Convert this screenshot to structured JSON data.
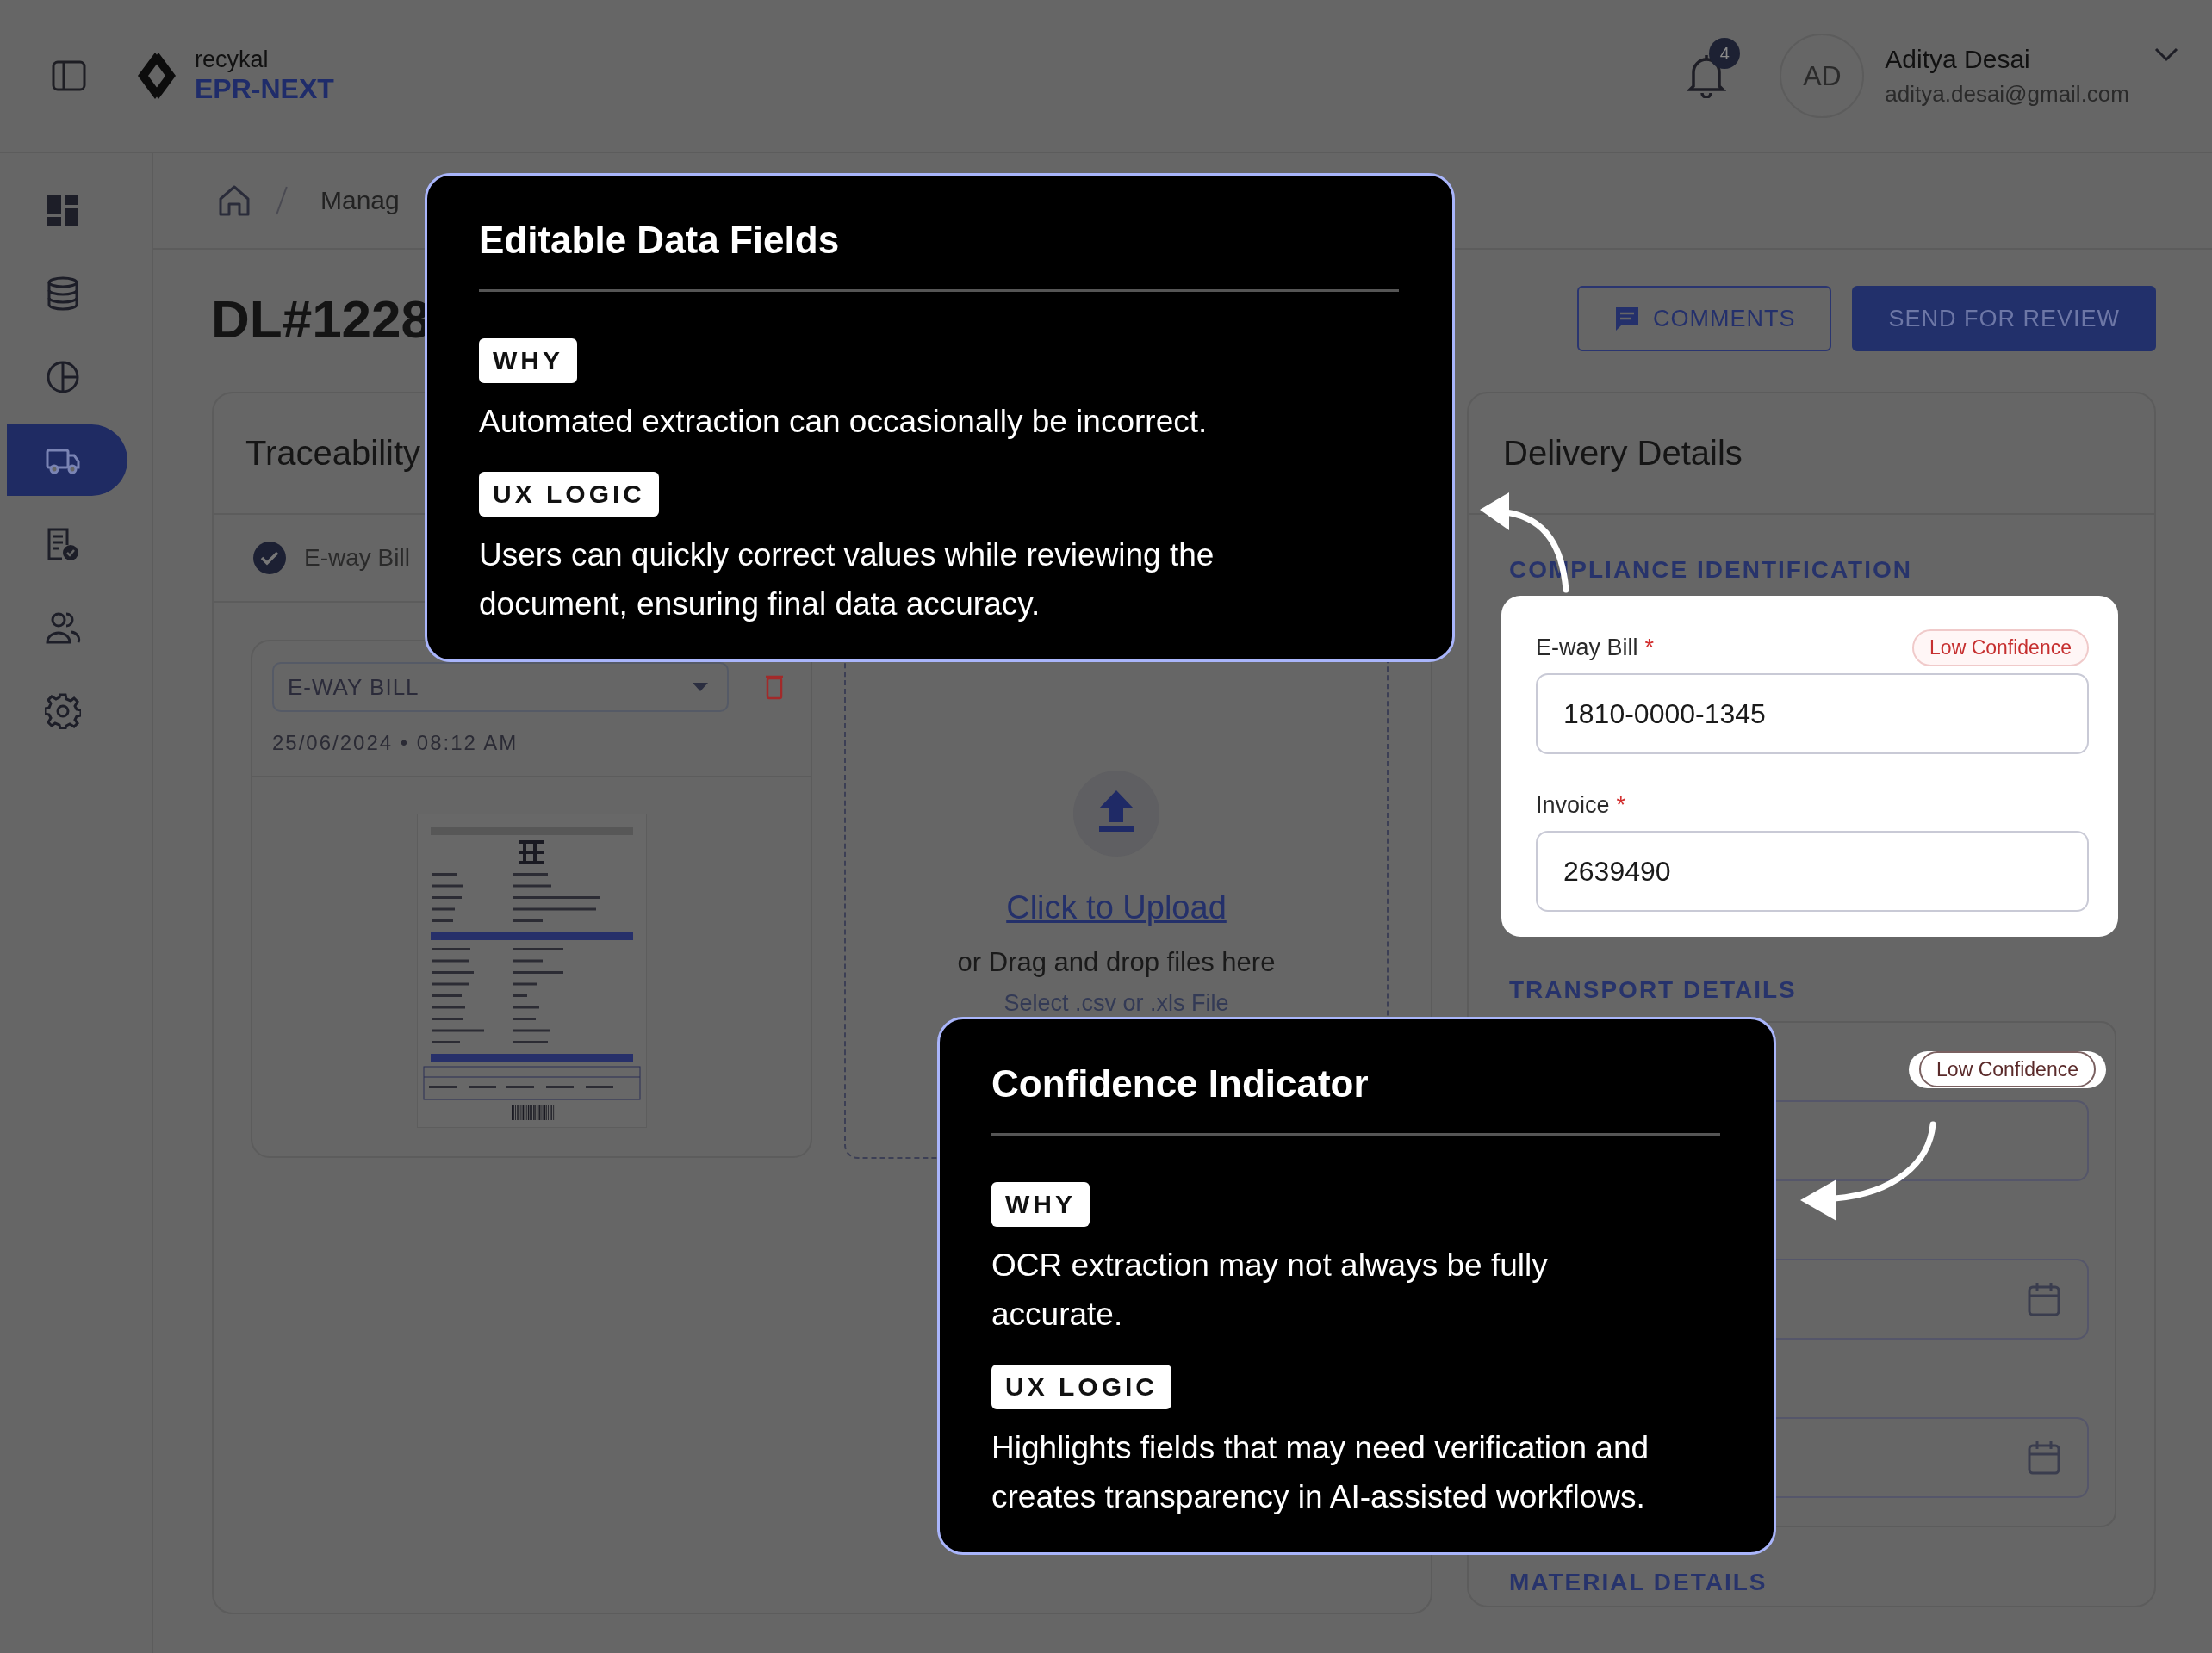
{
  "header": {
    "brand": "recykal",
    "product": "EPR-NEXT",
    "notifications": "4",
    "user": {
      "initials": "AD",
      "name": "Aditya Desai",
      "email": "aditya.desai@gmail.com"
    }
  },
  "sidebar": {
    "items": [
      {
        "selected": false
      },
      {
        "selected": false
      },
      {
        "selected": false
      },
      {
        "selected": true
      },
      {
        "selected": false
      },
      {
        "selected": false
      },
      {
        "selected": false
      }
    ]
  },
  "breadcrumb": [
    "Manag"
  ],
  "page": {
    "title": "DL#1228",
    "buttons": [
      {
        "label": "COMMENTS",
        "kind": "outline"
      },
      {
        "label": "SEND FOR REVIEW",
        "kind": "primary"
      }
    ]
  },
  "traceability": {
    "title": "Traceability",
    "tabs": [
      {
        "label": "E-way Bill",
        "checked": true
      }
    ],
    "document": {
      "type": "E-WAY BILL",
      "timestamp": "25/06/2024 • 08:12 AM"
    },
    "upload": {
      "link": "Click to Upload",
      "hint": "or Drag and drop files here",
      "formats": "Select .csv or .xls File"
    }
  },
  "delivery": {
    "title": "Delivery Details",
    "sections": [
      {
        "title": "COMPLIANCE IDENTIFICATION",
        "highlighted": true,
        "fields": [
          {
            "kind": "text",
            "label": "E-way Bill",
            "required_mark": "*",
            "value": "1810-0000-1345",
            "badge": "Low Confidence"
          },
          {
            "kind": "text",
            "label": "Invoice",
            "required_mark": "*",
            "value": "2639490"
          }
        ]
      },
      {
        "title": "TRANSPORT DETAILS",
        "highlighted": false,
        "fields": [
          {
            "kind": "text",
            "badge": "Low Confidence",
            "badge_highlighted": true
          },
          {
            "kind": "date"
          },
          {
            "kind": "date"
          }
        ]
      },
      {
        "title": "MATERIAL DETAILS"
      }
    ]
  },
  "tips": [
    {
      "title": "Editable Data Fields",
      "sections": [
        {
          "tag": "WHY",
          "text": "Automated extraction can occasionally be incorrect."
        },
        {
          "tag": "UX LOGIC",
          "text": "Users can quickly correct values while reviewing the document, ensuring final data accuracy."
        }
      ]
    },
    {
      "title": "Confidence Indicator",
      "sections": [
        {
          "tag": "WHY",
          "text": "OCR extraction may not always be fully accurate."
        },
        {
          "tag": "UX LOGIC",
          "text": "Highlights fields that may need verification and creates transparency in AI-assisted workflows."
        }
      ]
    }
  ]
}
